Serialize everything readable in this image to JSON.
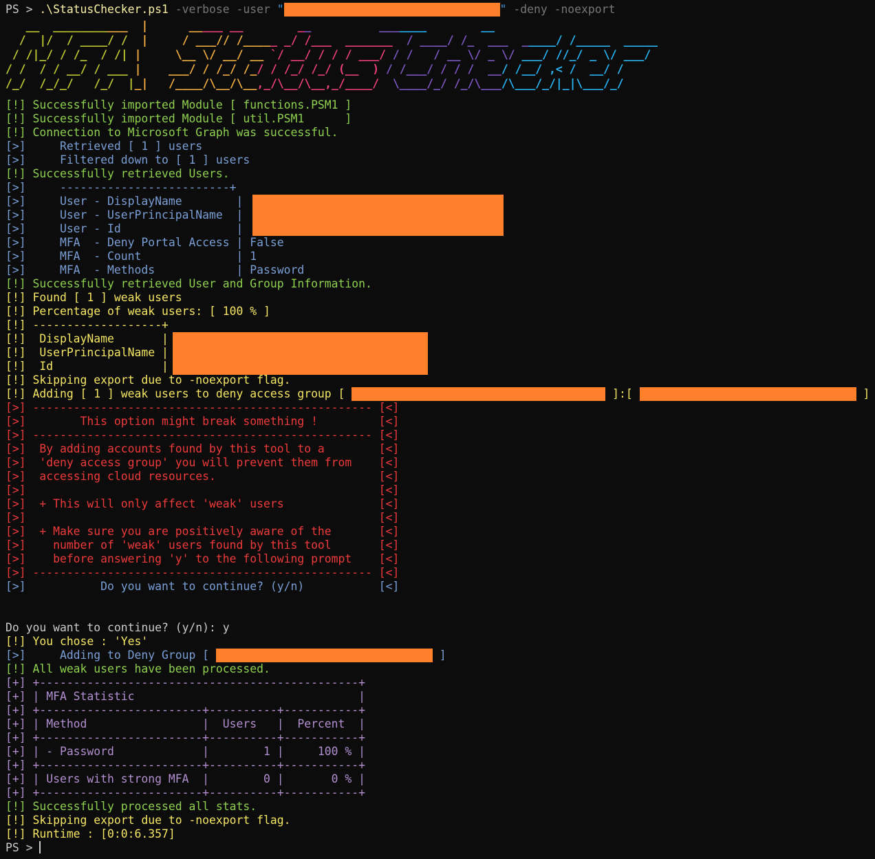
{
  "prompt": {
    "ps": "PS > ",
    "script": ".\\StatusChecker.ps1",
    "verbose_flag": " -verbose",
    "user_flag": " -user ",
    "quote_open": "\"",
    "quote_close": "\"",
    "deny_flag": " -deny",
    "noexport_flag": " -noexport"
  },
  "banner": {
    "lines": [
      "   __  ___________  |      _____ __        __          _______        __",
      "  /  |/  / ____/ /  |     / ___// /_____ _/ /___  _______  / ____/ /_  ___  _____/ /_____  _____",
      " / /|_/ / /_  / /| |     \\__ \\/ __/ __ `/ __/ / / / ___/ / /   / __ \\/ _ \\/ ___/ //_/ _ \\/ ___/",
      "/ /  / / __/ / ___ |    ___/ / /_/ /_/ / /_/ /_/ (__  ) / /___/ / / /  __/ /__/ ,< /  __/ /",
      "/_/  /_/_/   /_/  |_|   /____/\\__/\\__,_/\\__/\\__,_/____/  \\____/_/ /_/\\___/\\___/_/|_|\\___/_/"
    ],
    "colors": [
      "#c0ca33",
      "#f5b041",
      "#ec407a",
      "#7e57c2",
      "#29b6f6"
    ]
  },
  "log": {
    "bang": "[!]",
    "arrow": "[>]",
    "back": "[<]",
    "plus": "[+]",
    "import1": " Successfully imported Module [ functions.PSM1 ]",
    "import2": " Successfully imported Module [ util.PSM1      ]",
    "graph": " Connection to Microsoft Graph was successful.",
    "retrieved": "     Retrieved [ 1 ] users",
    "filtered": "     Filtered down to [ 1 ] users",
    "retrieved_users": " Successfully retrieved Users.",
    "tbl_top": "     -------------------------+",
    "u_display": "     User - DisplayName        | ",
    "u_upn": "     User - UserPrincipalName  | ",
    "u_id": "     User - Id                 | ",
    "mfa_deny": "     MFA  - Deny Portal Access | False",
    "mfa_count": "     MFA  - Count              | 1",
    "mfa_methods": "     MFA  - Methods            | Password",
    "retrieved_group": " Successfully retrieved User and Group Information.",
    "found_weak": " Found [ 1 ] weak users",
    "percentage": " Percentage of weak users: [ 100 % ]",
    "w_top": " -------------------+",
    "w_display": "  DisplayName       |",
    "w_upn": "  UserPrincipalName |",
    "w_id": "  Id                |",
    "skip_export": " Skipping export due to -noexport flag.",
    "adding_prefix": " Adding [ 1 ] weak users to deny access group [ ",
    "adding_middle": " ]:[ ",
    "adding_suffix": " ]",
    "warn_rule": " -------------------------------------------------- ",
    "warn_title": "        This option might break something !         ",
    "warn_l1": "  By adding accounts found by this tool to a        ",
    "warn_l2": "  'deny access group' you will prevent them from    ",
    "warn_l3": "  accessing cloud resources.                        ",
    "warn_blank": "                                                    ",
    "warn_weak": "  + This will only affect 'weak' users              ",
    "warn_aware1": "  + Make sure you are positively aware of the       ",
    "warn_aware2": "    number of 'weak' users found by this tool       ",
    "warn_aware3": "    before answering 'y' to the following prompt    ",
    "continue_q": "           Do you want to continue? (y/n)           ",
    "continue_input": "Do you want to continue? (y/n): y",
    "chose": " You chose : 'Yes'",
    "adding_deny": "     Adding to Deny Group [ ",
    "adding_deny_end": " ]",
    "processed": " All weak users have been processed.",
    "stat_border": " +-----------------------------------------------+",
    "stat_title": " | MFA Statistic                                 |",
    "stat_sep": " +------------------------+----------+-----------+",
    "stat_header": " | Method                 |  Users   |  Percent  |",
    "stat_pw": " | - Password             |        1 |     100 % |",
    "stat_strong": " | Users with strong MFA  |        0 |       0 % |",
    "stats_done": " Successfully processed all stats.",
    "runtime": " Runtime : [0:0:6.357]",
    "final_prompt": "PS > "
  }
}
